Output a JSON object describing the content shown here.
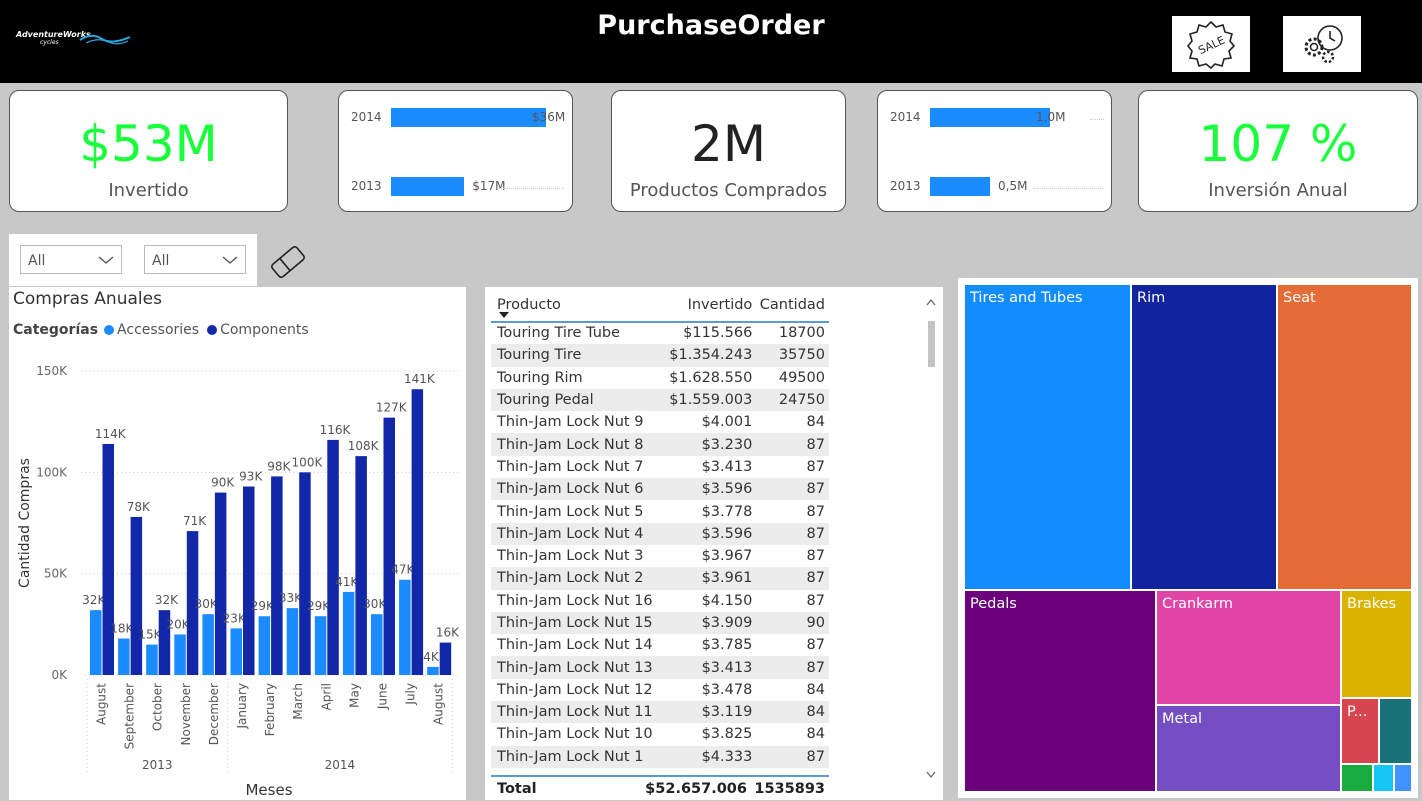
{
  "header": {
    "title": "PurchaseOrder",
    "logo_text": "AdventureWorks",
    "logo_sub": "cycles",
    "sale_button_icon": "sale-tag-icon",
    "settings_button_icon": "gears-clock-icon"
  },
  "kpis": {
    "invested": {
      "value": "$53M",
      "label": "Invertido",
      "color": "#1aff3c"
    },
    "products": {
      "value": "2M",
      "label": "Productos Comprados",
      "color": "#222222"
    },
    "annual": {
      "value": "107 %",
      "label": "Inversión Anual",
      "color": "#1aff3c"
    }
  },
  "mini_invested": {
    "rows": [
      {
        "year": "2014",
        "label": "$36M",
        "value": 36
      },
      {
        "year": "2013",
        "label": "$17M",
        "value": 17
      }
    ],
    "max": 36
  },
  "mini_qty": {
    "rows": [
      {
        "year": "2014",
        "label": "1,0M",
        "value": 1.0
      },
      {
        "year": "2013",
        "label": "0,5M",
        "value": 0.5
      }
    ],
    "max": 1.0
  },
  "slicers": [
    {
      "value": "All"
    },
    {
      "value": "All"
    }
  ],
  "chart_data": {
    "type": "bar",
    "title": "Compras Anuales",
    "legend_title": "Categorías",
    "xlabel": "Meses",
    "ylabel": "Cantidad Compras",
    "ylim": [
      0,
      150000
    ],
    "yticks": [
      "0K",
      "50K",
      "100K",
      "150K"
    ],
    "categories": [
      "August",
      "September",
      "October",
      "November",
      "December",
      "January",
      "February",
      "March",
      "April",
      "May",
      "June",
      "July",
      "August"
    ],
    "year_groups": [
      {
        "label": "2013",
        "count": 5
      },
      {
        "label": "2014",
        "count": 8
      }
    ],
    "series": [
      {
        "name": "Accessories",
        "color": "#1a8cff",
        "values": [
          32000,
          18000,
          15000,
          20000,
          30000,
          23000,
          29000,
          33000,
          29000,
          41000,
          30000,
          47000,
          4000
        ],
        "labels": [
          "32K",
          "18K",
          "15K",
          "20K",
          "30K",
          "23K",
          "29K",
          "33K",
          "29K",
          "41K",
          "30K",
          "47K",
          "4K"
        ]
      },
      {
        "name": "Components",
        "color": "#1228a8",
        "values": [
          114000,
          78000,
          32000,
          71000,
          90000,
          93000,
          98000,
          100000,
          116000,
          108000,
          127000,
          141000,
          16000
        ],
        "labels": [
          "114K",
          "78K",
          "32K",
          "71K",
          "90K",
          "93K",
          "98K",
          "100K",
          "116K",
          "108K",
          "127K",
          "141K",
          "16K"
        ]
      }
    ],
    "grid": true
  },
  "table": {
    "columns": [
      "Producto",
      "Invertido",
      "Cantidad"
    ],
    "rows": [
      [
        "Touring Tire Tube",
        "$115.566",
        "18700"
      ],
      [
        "Touring Tire",
        "$1.354.243",
        "35750"
      ],
      [
        "Touring Rim",
        "$1.628.550",
        "49500"
      ],
      [
        "Touring Pedal",
        "$1.559.003",
        "24750"
      ],
      [
        "Thin-Jam Lock Nut 9",
        "$4.001",
        "84"
      ],
      [
        "Thin-Jam Lock Nut 8",
        "$3.230",
        "87"
      ],
      [
        "Thin-Jam Lock Nut 7",
        "$3.413",
        "87"
      ],
      [
        "Thin-Jam Lock Nut 6",
        "$3.596",
        "87"
      ],
      [
        "Thin-Jam Lock Nut 5",
        "$3.778",
        "87"
      ],
      [
        "Thin-Jam Lock Nut 4",
        "$3.596",
        "87"
      ],
      [
        "Thin-Jam Lock Nut 3",
        "$3.967",
        "87"
      ],
      [
        "Thin-Jam Lock Nut 2",
        "$3.961",
        "87"
      ],
      [
        "Thin-Jam Lock Nut 16",
        "$4.150",
        "87"
      ],
      [
        "Thin-Jam Lock Nut 15",
        "$3.909",
        "90"
      ],
      [
        "Thin-Jam Lock Nut 14",
        "$3.785",
        "87"
      ],
      [
        "Thin-Jam Lock Nut 13",
        "$3.413",
        "87"
      ],
      [
        "Thin-Jam Lock Nut 12",
        "$3.478",
        "84"
      ],
      [
        "Thin-Jam Lock Nut 11",
        "$3.119",
        "84"
      ],
      [
        "Thin-Jam Lock Nut 10",
        "$3.825",
        "84"
      ],
      [
        "Thin-Jam Lock Nut 1",
        "$4.333",
        "87"
      ]
    ],
    "total": [
      "Total",
      "$52.657.006",
      "1535893"
    ]
  },
  "treemap": [
    {
      "name": "Tires and Tubes",
      "color": "#118dff"
    },
    {
      "name": "Rim",
      "color": "#12239e"
    },
    {
      "name": "Seat",
      "color": "#e66c37"
    },
    {
      "name": "Pedals",
      "color": "#6b007b"
    },
    {
      "name": "Crankarm",
      "color": "#e044a7"
    },
    {
      "name": "Brakes",
      "color": "#d9b300"
    },
    {
      "name": "Metal",
      "color": "#744ec2"
    },
    {
      "name": "P...",
      "color": "#d64550"
    },
    {
      "name": "",
      "color": "#197278"
    },
    {
      "name": "",
      "color": "#1aab40"
    },
    {
      "name": "",
      "color": "#15c6f4"
    },
    {
      "name": "",
      "color": "#4092ff"
    }
  ]
}
